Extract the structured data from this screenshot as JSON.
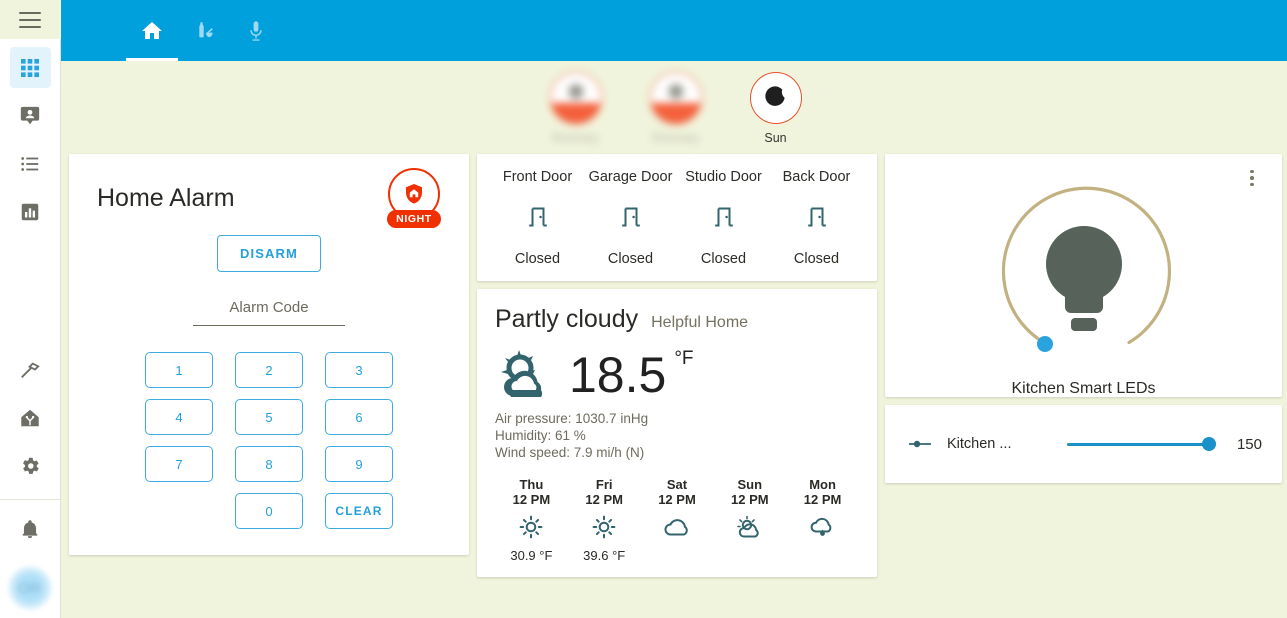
{
  "sidebar": {
    "menu_icon": "hamburger-menu-icon",
    "items": [
      {
        "name": "overview",
        "icon": "apps-grid-icon",
        "active": true
      },
      {
        "name": "map",
        "icon": "map-marker-account-icon",
        "active": false
      },
      {
        "name": "logbook",
        "icon": "logbook-list-icon",
        "active": false
      },
      {
        "name": "history",
        "icon": "chart-bar-icon",
        "active": false
      },
      {
        "name": "developer-tools",
        "icon": "hammer-icon",
        "active": false
      },
      {
        "name": "supervisor",
        "icon": "home-assistant-logo-icon",
        "active": false
      },
      {
        "name": "settings",
        "icon": "gear-icon",
        "active": false
      }
    ],
    "notifications_icon": "bell-icon",
    "avatar_initials": "OR"
  },
  "toolbar": {
    "tabs": [
      {
        "name": "home",
        "icon": "home-icon",
        "active": true
      },
      {
        "name": "kitchen",
        "icon": "bottle-mortar-icon",
        "active": false
      },
      {
        "name": "voice",
        "icon": "microphone-icon",
        "active": false
      }
    ],
    "accent_color": "#00a0dc"
  },
  "badges": [
    {
      "label": "Romney",
      "icon": "person-avatar-icon",
      "blurred": true
    },
    {
      "label": "Romney",
      "icon": "person-avatar-icon",
      "blurred": true
    },
    {
      "label": "Sun",
      "icon": "moon-waning-crescent-icon",
      "blurred": false
    }
  ],
  "alarm": {
    "title": "Home Alarm",
    "state_badge": "NIGHT",
    "state_icon": "shield-home-icon",
    "state_color": "#f03000",
    "disarm_label": "DISARM",
    "code_placeholder": "Alarm Code",
    "code_value": "",
    "keys": [
      "1",
      "2",
      "3",
      "4",
      "5",
      "6",
      "7",
      "8",
      "9",
      "",
      "0",
      "CLEAR"
    ]
  },
  "doors": [
    {
      "name": "Front Door",
      "state": "Closed",
      "icon": "door-closed-icon"
    },
    {
      "name": "Garage Door",
      "state": "Closed",
      "icon": "door-closed-icon"
    },
    {
      "name": "Studio Door",
      "state": "Closed",
      "icon": "door-closed-icon"
    },
    {
      "name": "Back Door",
      "state": "Closed",
      "icon": "door-closed-icon"
    }
  ],
  "weather": {
    "condition": "Partly cloudy",
    "location": "Helpful Home",
    "icon": "partly-cloudy-icon",
    "temperature": "18.5",
    "temperature_unit": "°F",
    "air_pressure": "Air pressure: 1030.7 inHg",
    "humidity": "Humidity: 61 %",
    "wind_speed": "Wind speed: 7.9 mi/h (N)",
    "forecast": [
      {
        "day": "Thu",
        "time": "12 PM",
        "icon": "sunny-icon",
        "temp": "30.9 °F"
      },
      {
        "day": "Fri",
        "time": "12 PM",
        "icon": "sunny-icon",
        "temp": "39.6 °F"
      },
      {
        "day": "Sat",
        "time": "12 PM",
        "icon": "cloudy-icon",
        "temp": ""
      },
      {
        "day": "Sun",
        "time": "12 PM",
        "icon": "partly-cloudy-icon",
        "temp": ""
      },
      {
        "day": "Mon",
        "time": "12 PM",
        "icon": "rainy-icon",
        "temp": ""
      }
    ]
  },
  "light": {
    "name": "Kitchen Smart LEDs",
    "icon": "lightbulb-icon",
    "menu_icon": "dots-vertical-icon",
    "dial_color": "#c2b181",
    "handle_color": "#29a3dd",
    "bulb_color": "#56625a",
    "brightness_percent": 2
  },
  "slider_row": {
    "icon": "brightness-slider-icon",
    "label": "Kitchen ...",
    "value": "150",
    "fill_percent": 97,
    "color": "#1a91c8"
  }
}
